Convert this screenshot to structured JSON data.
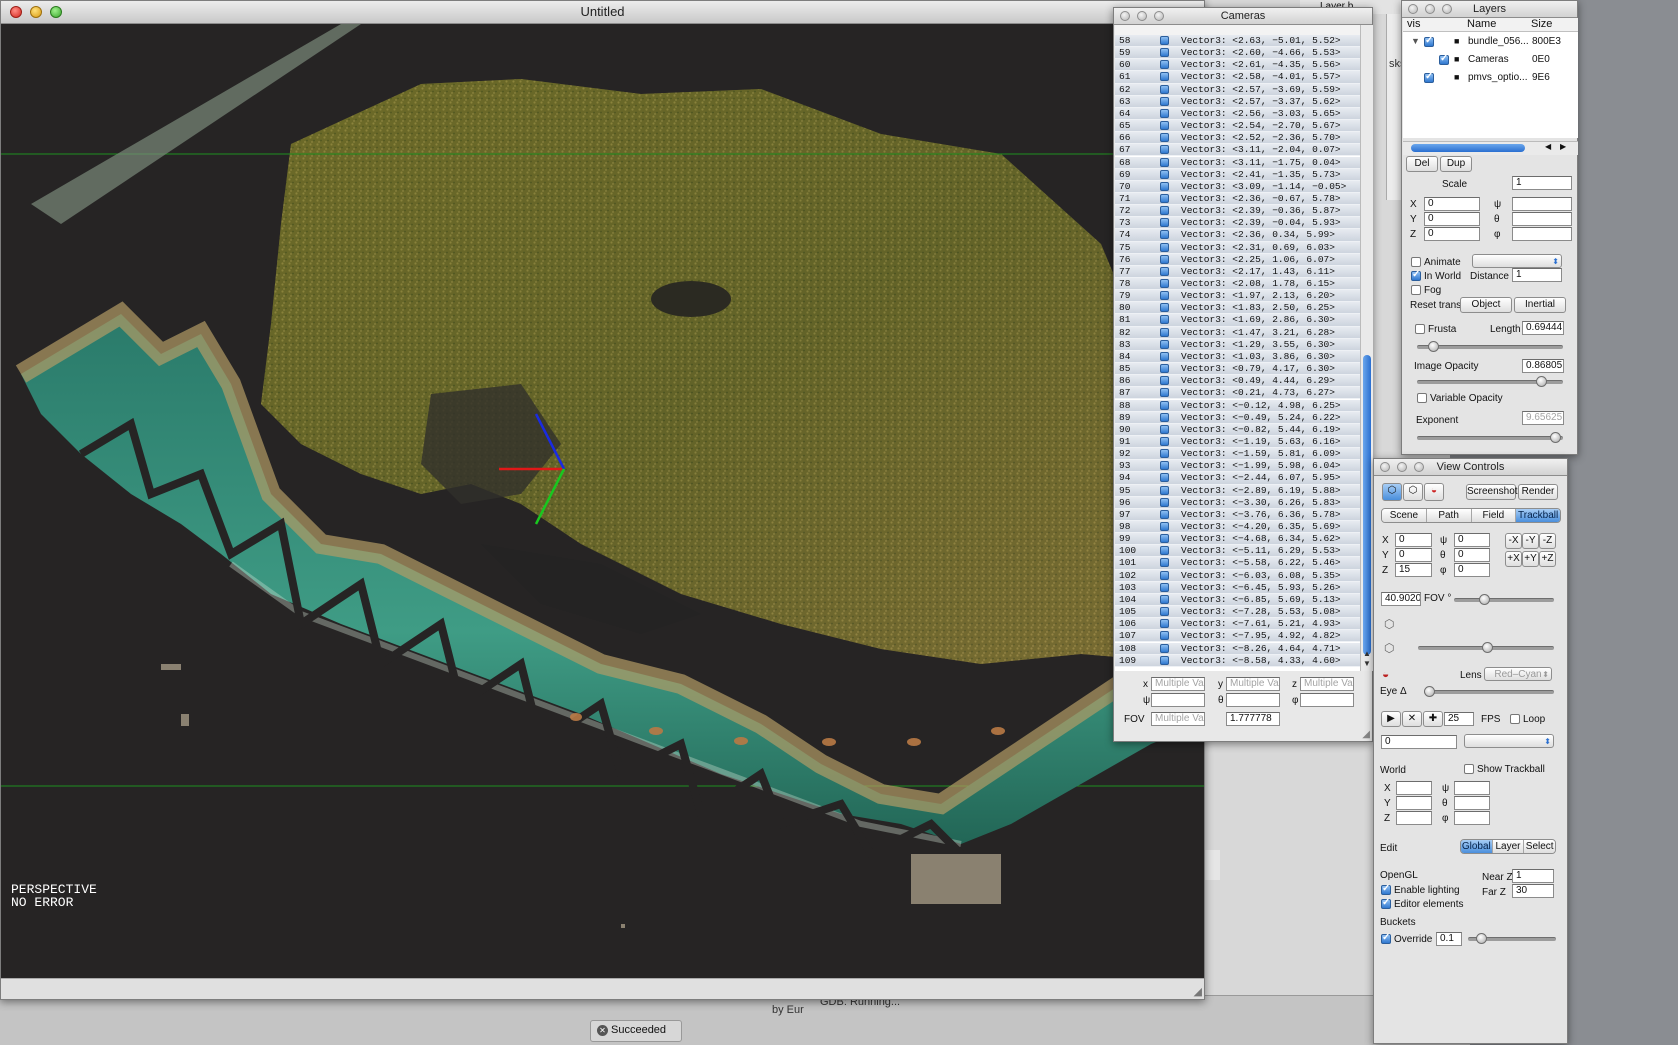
{
  "viewer": {
    "title": "Untitled",
    "overlay_line1": "PERSPECTIVE",
    "overlay_line2": "NO ERROR"
  },
  "background": {
    "tasks_label": "sks",
    "succeeded_left": "Succeeded",
    "succeeded_right": "eeded",
    "layer_tab": "Layer b",
    "gdb_status": "GDB: Running...",
    "by_label": "by Eur"
  },
  "cameras": {
    "title": "Cameras",
    "rows": [
      {
        "n": "58",
        "v": "Vector3: <2.63, −5.01, 5.52>"
      },
      {
        "n": "59",
        "v": "Vector3: <2.60, −4.66, 5.53>"
      },
      {
        "n": "60",
        "v": "Vector3: <2.61, −4.35, 5.56>"
      },
      {
        "n": "61",
        "v": "Vector3: <2.58, −4.01, 5.57>"
      },
      {
        "n": "62",
        "v": "Vector3: <2.57, −3.69, 5.59>"
      },
      {
        "n": "63",
        "v": "Vector3: <2.57, −3.37, 5.62>"
      },
      {
        "n": "64",
        "v": "Vector3: <2.56, −3.03, 5.65>"
      },
      {
        "n": "65",
        "v": "Vector3: <2.54, −2.70, 5.67>"
      },
      {
        "n": "66",
        "v": "Vector3: <2.52, −2.36, 5.70>"
      },
      {
        "n": "67",
        "v": "Vector3: <3.11, −2.04, 0.07>"
      },
      {
        "n": "68",
        "v": "Vector3: <3.11, −1.75, 0.04>"
      },
      {
        "n": "69",
        "v": "Vector3: <2.41, −1.35, 5.73>"
      },
      {
        "n": "70",
        "v": "Vector3: <3.09, −1.14, −0.05>"
      },
      {
        "n": "71",
        "v": "Vector3: <2.36, −0.67, 5.78>"
      },
      {
        "n": "72",
        "v": "Vector3: <2.39, −0.36, 5.87>"
      },
      {
        "n": "73",
        "v": "Vector3: <2.39, −0.04, 5.93>"
      },
      {
        "n": "74",
        "v": "Vector3: <2.36, 0.34, 5.99>"
      },
      {
        "n": "75",
        "v": "Vector3: <2.31, 0.69, 6.03>"
      },
      {
        "n": "76",
        "v": "Vector3: <2.25, 1.06, 6.07>"
      },
      {
        "n": "77",
        "v": "Vector3: <2.17, 1.43, 6.11>"
      },
      {
        "n": "78",
        "v": "Vector3: <2.08, 1.78, 6.15>"
      },
      {
        "n": "79",
        "v": "Vector3: <1.97, 2.13, 6.20>"
      },
      {
        "n": "80",
        "v": "Vector3: <1.83, 2.50, 6.25>"
      },
      {
        "n": "81",
        "v": "Vector3: <1.69, 2.86, 6.30>"
      },
      {
        "n": "82",
        "v": "Vector3: <1.47, 3.21, 6.28>"
      },
      {
        "n": "83",
        "v": "Vector3: <1.29, 3.55, 6.30>"
      },
      {
        "n": "84",
        "v": "Vector3: <1.03, 3.86, 6.30>"
      },
      {
        "n": "85",
        "v": "Vector3: <0.79, 4.17, 6.30>"
      },
      {
        "n": "86",
        "v": "Vector3: <0.49, 4.44, 6.29>"
      },
      {
        "n": "87",
        "v": "Vector3: <0.21, 4.73, 6.27>"
      },
      {
        "n": "88",
        "v": "Vector3: <−0.12, 4.98, 6.25>"
      },
      {
        "n": "89",
        "v": "Vector3: <−0.49, 5.24, 6.22>"
      },
      {
        "n": "90",
        "v": "Vector3: <−0.82, 5.44, 6.19>"
      },
      {
        "n": "91",
        "v": "Vector3: <−1.19, 5.63, 6.16>"
      },
      {
        "n": "92",
        "v": "Vector3: <−1.59, 5.81, 6.09>"
      },
      {
        "n": "93",
        "v": "Vector3: <−1.99, 5.98, 6.04>"
      },
      {
        "n": "94",
        "v": "Vector3: <−2.44, 6.07, 5.95>"
      },
      {
        "n": "95",
        "v": "Vector3: <−2.89, 6.19, 5.88>"
      },
      {
        "n": "96",
        "v": "Vector3: <−3.30, 6.26, 5.83>"
      },
      {
        "n": "97",
        "v": "Vector3: <−3.76, 6.36, 5.78>"
      },
      {
        "n": "98",
        "v": "Vector3: <−4.20, 6.35, 5.69>"
      },
      {
        "n": "99",
        "v": "Vector3: <−4.68, 6.34, 5.62>"
      },
      {
        "n": "100",
        "v": "Vector3: <−5.11, 6.29, 5.53>"
      },
      {
        "n": "101",
        "v": "Vector3: <−5.58, 6.22, 5.46>"
      },
      {
        "n": "102",
        "v": "Vector3: <−6.03, 6.08, 5.35>"
      },
      {
        "n": "103",
        "v": "Vector3: <−6.45, 5.93, 5.26>"
      },
      {
        "n": "104",
        "v": "Vector3: <−6.85, 5.69, 5.13>"
      },
      {
        "n": "105",
        "v": "Vector3: <−7.28, 5.53, 5.08>"
      },
      {
        "n": "106",
        "v": "Vector3: <−7.61, 5.21, 4.93>"
      },
      {
        "n": "107",
        "v": "Vector3: <−7.95, 4.92, 4.82>"
      },
      {
        "n": "108",
        "v": "Vector3: <−8.26, 4.64, 4.71>"
      },
      {
        "n": "109",
        "v": "Vector3: <−8.58, 4.33, 4.60>"
      }
    ],
    "fields": {
      "x_label": "x",
      "y_label": "y",
      "z_label": "z",
      "psi_label": "ψ",
      "theta_label": "θ",
      "phi_label": "φ",
      "fov_label": "FOV",
      "placeholder": "Multiple Va",
      "aspect_value": "1.777778"
    }
  },
  "layers": {
    "title": "Layers",
    "col_vis": "vis",
    "col_name": "Name",
    "col_size": "Size",
    "items": [
      {
        "name": "bundle_056...",
        "size": "800E3"
      },
      {
        "name": "Cameras",
        "size": "0E0"
      },
      {
        "name": "pmvs_optio...",
        "size": "9E6"
      }
    ],
    "del_label": "Del",
    "dup_label": "Dup",
    "scale_label": "Scale",
    "scale_value": "1",
    "x_label": "X",
    "y_label": "Y",
    "z_label": "Z",
    "x_value": "0",
    "y_value": "0",
    "z_value": "0",
    "psi_label": "ψ",
    "theta_label": "θ",
    "phi_label": "φ",
    "animate_label": "Animate",
    "in_world_label": "In World",
    "distance_label": "Distance",
    "distance_value": "1",
    "fog_label": "Fog",
    "reset_label": "Reset trans:",
    "object_label": "Object",
    "inertial_label": "Inertial",
    "frusta_label": "Frusta",
    "length_label": "Length",
    "length_value": "0.69444",
    "length_level": 0.08,
    "image_opacity_label": "Image Opacity",
    "image_opacity_value": "0.86805",
    "image_opacity_level": 0.86805,
    "variable_opacity_label": "Variable Opacity",
    "exponent_label": "Exponent",
    "exponent_value": "9.65625",
    "exponent_level": 0.97
  },
  "view_controls": {
    "title": "View Controls",
    "screenshot_label": "Screenshot",
    "render_label": "Render",
    "tabs": [
      "Scene",
      "Path",
      "Field",
      "Trackball"
    ],
    "x_label": "X",
    "y_label": "Y",
    "z_label": "Z",
    "x_value": "0",
    "y_value": "0",
    "z_value": "15",
    "psi_label": "ψ",
    "theta_label": "θ",
    "phi_label": "φ",
    "psi_value": "0",
    "theta_value": "0",
    "phi_value": "0",
    "axis_neg": [
      "-X",
      "-Y",
      "-Z"
    ],
    "axis_pos": [
      "+X",
      "+Y",
      "+Z"
    ],
    "fov_value": "40.90200",
    "fov_label": "FOV °",
    "fov_level": 0.28,
    "persp_level": 0.5,
    "lens_label": "Lens",
    "lens_value": "Red–Cyan",
    "eye_label": "Eye Δ",
    "eye_level": 0.0,
    "fps_value": "25",
    "fps_label": "FPS",
    "loop_label": "Loop",
    "frame_value": "0",
    "world_label": "World",
    "show_trackball_label": "Show Trackball",
    "edit_label": "Edit",
    "edit_options": [
      "Global",
      "Layer",
      "Select"
    ],
    "opengl_label": "OpenGL",
    "near_z_label": "Near Z",
    "near_z_value": "1",
    "far_z_label": "Far Z",
    "far_z_value": "30",
    "enable_lighting_label": "Enable lighting",
    "editor_elements_label": "Editor elements",
    "buckets_label": "Buckets",
    "override_label": "Override",
    "override_value": "0.1",
    "override_level": 0.1
  }
}
